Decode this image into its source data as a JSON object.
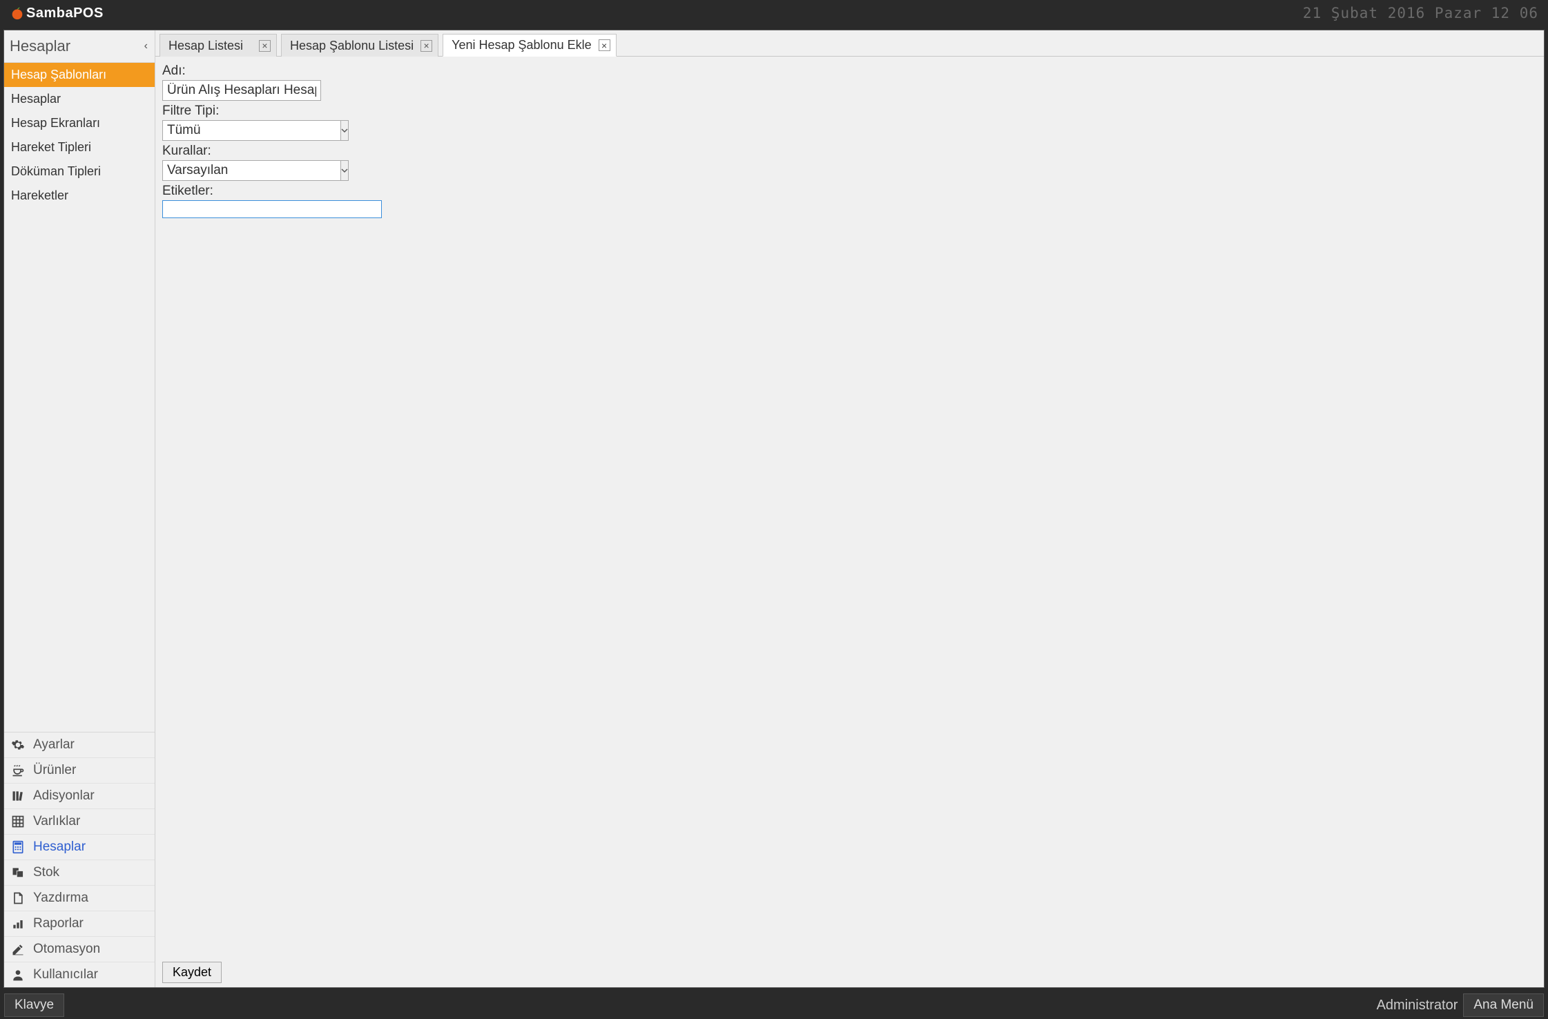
{
  "titlebar": {
    "brand": "SambaPOS",
    "datetime": "21 Şubat 2016 Pazar 12 06"
  },
  "sidebar": {
    "header": "Hesaplar",
    "subnav": [
      {
        "label": "Hesap Şablonları",
        "active": true
      },
      {
        "label": "Hesaplar"
      },
      {
        "label": "Hesap Ekranları"
      },
      {
        "label": "Hareket Tipleri"
      },
      {
        "label": "Döküman Tipleri"
      },
      {
        "label": "Hareketler"
      }
    ],
    "mainnav": [
      {
        "icon": "gear-icon",
        "label": "Ayarlar"
      },
      {
        "icon": "cup-icon",
        "label": "Ürünler"
      },
      {
        "icon": "books-icon",
        "label": "Adisyonlar"
      },
      {
        "icon": "grid-icon",
        "label": "Varlıklar"
      },
      {
        "icon": "calc-icon",
        "label": "Hesaplar",
        "active": true
      },
      {
        "icon": "stack-icon",
        "label": "Stok"
      },
      {
        "icon": "page-icon",
        "label": "Yazdırma"
      },
      {
        "icon": "bars-icon",
        "label": "Raporlar"
      },
      {
        "icon": "pen-icon",
        "label": "Otomasyon"
      },
      {
        "icon": "user-icon",
        "label": "Kullanıcılar"
      }
    ]
  },
  "tabs": [
    {
      "label": "Hesap Listesi"
    },
    {
      "label": "Hesap Şablonu Listesi"
    },
    {
      "label": "Yeni Hesap Şablonu Ekle",
      "active": true
    }
  ],
  "form": {
    "name_label": "Adı:",
    "name_value": "Ürün Alış Hesapları Hesapları",
    "filter_label": "Filtre Tipi:",
    "filter_value": "Tümü",
    "rules_label": "Kurallar:",
    "rules_value": "Varsayılan",
    "tags_label": "Etiketler:",
    "tags_value": "",
    "save_label": "Kaydet"
  },
  "statusbar": {
    "keyboard_label": "Klavye",
    "user": "Administrator",
    "mainmenu_label": "Ana Menü"
  }
}
